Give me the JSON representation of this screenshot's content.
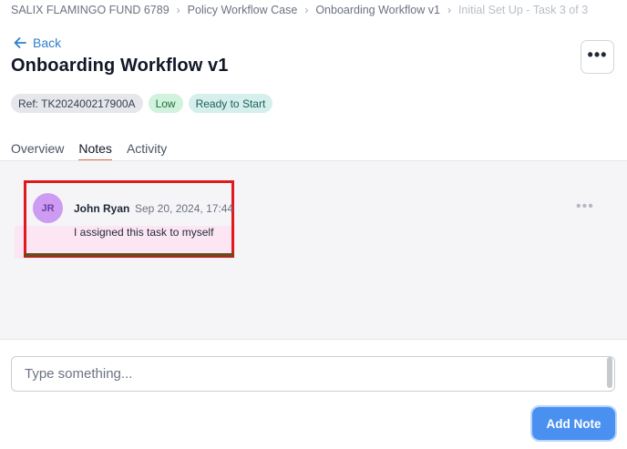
{
  "breadcrumb": {
    "items": [
      {
        "label": "SALIX FLAMINGO FUND 6789"
      },
      {
        "label": "Policy Workflow Case"
      },
      {
        "label": "Onboarding Workflow v1"
      },
      {
        "label": "Initial Set Up - Task 3 of 3"
      }
    ],
    "separator": "›"
  },
  "header": {
    "back_label": "Back",
    "title": "Onboarding Workflow v1",
    "more_icon": "ellipsis-icon",
    "more_label": "•••"
  },
  "badges": {
    "ref": "Ref: TK202400217900A",
    "priority": "Low",
    "status": "Ready to Start"
  },
  "tabs": [
    {
      "label": "Overview",
      "active": false
    },
    {
      "label": "Notes",
      "active": true
    },
    {
      "label": "Activity",
      "active": false
    }
  ],
  "notes": [
    {
      "initials": "JR",
      "author": "John Ryan",
      "timestamp": "Sep 20, 2024, 17:44",
      "text": "I assigned this task to myself",
      "menu_label": "•••"
    }
  ],
  "composer": {
    "placeholder": "Type something...",
    "value": "",
    "submit_label": "Add Note"
  },
  "colors": {
    "accent": "#2f80c9",
    "tab_underline": "#e86d3b",
    "button": "#4a90f0",
    "avatar": "#cd9cf2",
    "highlight_border": "#e0191e"
  }
}
